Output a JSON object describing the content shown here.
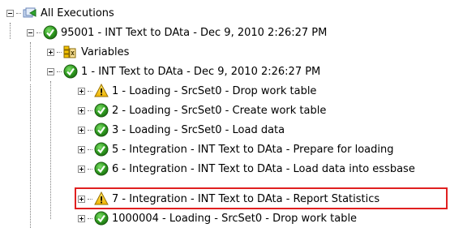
{
  "tree": {
    "root": {
      "label": "All Executions",
      "icon": "executions-folder-icon"
    },
    "session": {
      "label": "95001 - INT Text to DAta - Dec 9, 2010 2:26:27 PM",
      "icon": "success-check-icon"
    },
    "variables": {
      "label": "Variables",
      "icon": "variables-icon"
    },
    "step": {
      "label": "1 - INT Text to DAta - Dec 9, 2010 2:26:27 PM",
      "icon": "success-check-icon"
    },
    "tasks": [
      {
        "label": "1 - Loading - SrcSet0 - Drop work table",
        "status": "warning"
      },
      {
        "label": "2 - Loading - SrcSet0 - Create work table",
        "status": "success"
      },
      {
        "label": "3 - Loading - SrcSet0 - Load data",
        "status": "success"
      },
      {
        "label": "5 - Integration - INT Text to DAta - Prepare for loading",
        "status": "success"
      },
      {
        "label": "6 - Integration - INT Text to DAta - Load data into essbase",
        "status": "success"
      },
      {
        "label": "7 - Integration - INT Text to DAta - Report Statistics",
        "status": "warning"
      },
      {
        "label": "1000004 - Loading - SrcSet0 - Drop work table",
        "status": "success"
      }
    ]
  },
  "colors": {
    "success": "#2e8b1e",
    "warning": "#f2c300",
    "highlight": "#e02020"
  }
}
